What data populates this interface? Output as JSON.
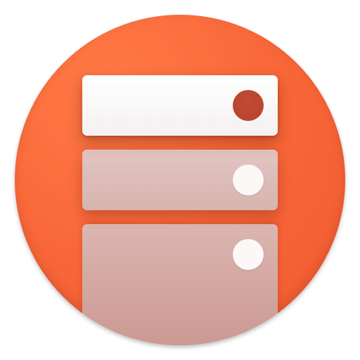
{
  "icon": {
    "semantic": "server-storage-icon",
    "colors": {
      "background": "#f9683a",
      "active_bay": "#ffffff",
      "inactive_bay": "#d7b4b0",
      "active_led": "#b5432f",
      "inactive_led": "#fbf8f7"
    },
    "bays": [
      {
        "name": "drive-bay-1",
        "state": "active"
      },
      {
        "name": "drive-bay-2",
        "state": "inactive"
      },
      {
        "name": "drive-bay-3",
        "state": "inactive"
      }
    ]
  }
}
